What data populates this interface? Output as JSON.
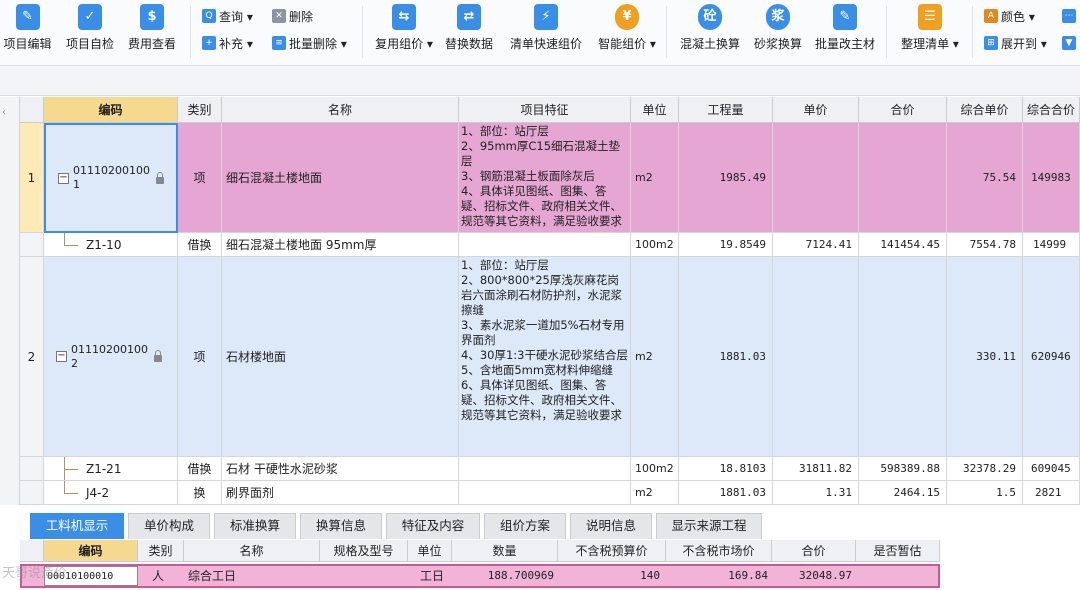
{
  "toolbar": {
    "buttons": [
      {
        "label": "项目编辑",
        "icon": "project-edit-icon"
      },
      {
        "label": "项目自检",
        "icon": "project-check-icon"
      },
      {
        "label": "费用查看",
        "icon": "cost-view-icon"
      },
      {
        "label": "复用组价 ▾",
        "icon": "reuse-price-icon"
      },
      {
        "label": "替换数据",
        "icon": "replace-data-icon"
      },
      {
        "label": "清单快速组价",
        "icon": "quick-price-icon"
      },
      {
        "label": "智能组价 ▾",
        "icon": "smart-price-icon"
      },
      {
        "label": "混凝土换算",
        "icon": "concrete-convert-icon"
      },
      {
        "label": "砂浆换算",
        "icon": "mortar-convert-icon"
      },
      {
        "label": "批量改主材",
        "icon": "batch-material-icon"
      },
      {
        "label": "整理清单 ▾",
        "icon": "organize-list-icon"
      }
    ],
    "small": [
      {
        "label": "查询 ▾",
        "icon": "query-icon"
      },
      {
        "label": "删除",
        "icon": "delete-icon"
      },
      {
        "label": "补充 ▾",
        "icon": "supplement-icon"
      },
      {
        "label": "批量删除 ▾",
        "icon": "batch-delete-icon"
      },
      {
        "label": "颜色 ▾",
        "icon": "color-icon"
      },
      {
        "label": "展开到 ▾",
        "icon": "expand-to-icon"
      }
    ],
    "glyphs": {
      "concrete": "砼",
      "mortar": "浆"
    }
  },
  "grid": {
    "headers": [
      "编码",
      "类别",
      "名称",
      "项目特征",
      "单位",
      "工程量",
      "单价",
      "合价",
      "综合单价",
      "综合合价"
    ],
    "rows": [
      {
        "no": "1",
        "code_line1": "01110200100",
        "code_line2": "1",
        "type": "项",
        "name": "细石混凝土楼地面",
        "feature": "1、部位：站厅层\n2、95mm厚C15细石混凝土垫层\n3、钢筋混凝土板面除灰后\n4、具体详见图纸、图集、答疑、招标文件、政府相关文件、规范等其它资料，满足验收要求",
        "unit": "m2",
        "qty": "1985.49",
        "price": "",
        "total": "",
        "comp_price": "75.54",
        "comp_total": "149983"
      },
      {
        "no": "",
        "code": "Z1-10",
        "type": "借换",
        "name": "细石混凝土楼地面 95mm厚",
        "feature": "",
        "unit": "100m2",
        "qty": "19.8549",
        "price": "7124.41",
        "total": "141454.45",
        "comp_price": "7554.78",
        "comp_total": "14999"
      },
      {
        "no": "2",
        "code_line1": "01110200100",
        "code_line2": "2",
        "type": "项",
        "name": "石材楼地面",
        "feature": "1、部位：站厅层\n2、800*800*25厚浅灰麻花岗岩六面涂刷石材防护剂，水泥浆擦缝\n3、素水泥浆一道加5%石材专用界面剂\n4、30厚1:3干硬水泥砂浆结合层\n5、含地面5mm宽材料伸缩缝\n6、具体详见图纸、图集、答疑、招标文件、政府相关文件、规范等其它资料，满足验收要求",
        "unit": "m2",
        "qty": "1881.03",
        "price": "",
        "total": "",
        "comp_price": "330.11",
        "comp_total": "620946"
      },
      {
        "no": "",
        "code": "Z1-21",
        "type": "借换",
        "name": "石材 干硬性水泥砂浆",
        "feature": "",
        "unit": "100m2",
        "qty": "18.8103",
        "price": "31811.82",
        "total": "598389.88",
        "comp_price": "32378.29",
        "comp_total": "609045"
      },
      {
        "no": "",
        "code": "J4-2",
        "type": "换",
        "name": "刷界面剂",
        "feature": "",
        "unit": "m2",
        "qty": "1881.03",
        "price": "1.31",
        "total": "2464.15",
        "comp_price": "1.5",
        "comp_total": "2821"
      }
    ]
  },
  "tabs": [
    "工料机显示",
    "单价构成",
    "标准换算",
    "换算信息",
    "特征及内容",
    "组价方案",
    "说明信息",
    "显示来源工程"
  ],
  "bottom_grid": {
    "headers": [
      "编码",
      "类别",
      "名称",
      "规格及型号",
      "单位",
      "数量",
      "不含税预算价",
      "不含税市场价",
      "合价",
      "是否暂估"
    ],
    "row": {
      "code": "00010100010",
      "type": "人",
      "name": "综合工日",
      "spec": "",
      "unit": "工日",
      "qty": "188.700969",
      "budget": "140",
      "market": "169.84",
      "total": "32048.97",
      "temp": ""
    }
  },
  "watermark": "天哥说造价",
  "colors": {
    "accent": "#3a8ee6",
    "selected_row": "#e6a6d3",
    "item_row": "#dde9f8",
    "header_active": "#f5d98e"
  }
}
